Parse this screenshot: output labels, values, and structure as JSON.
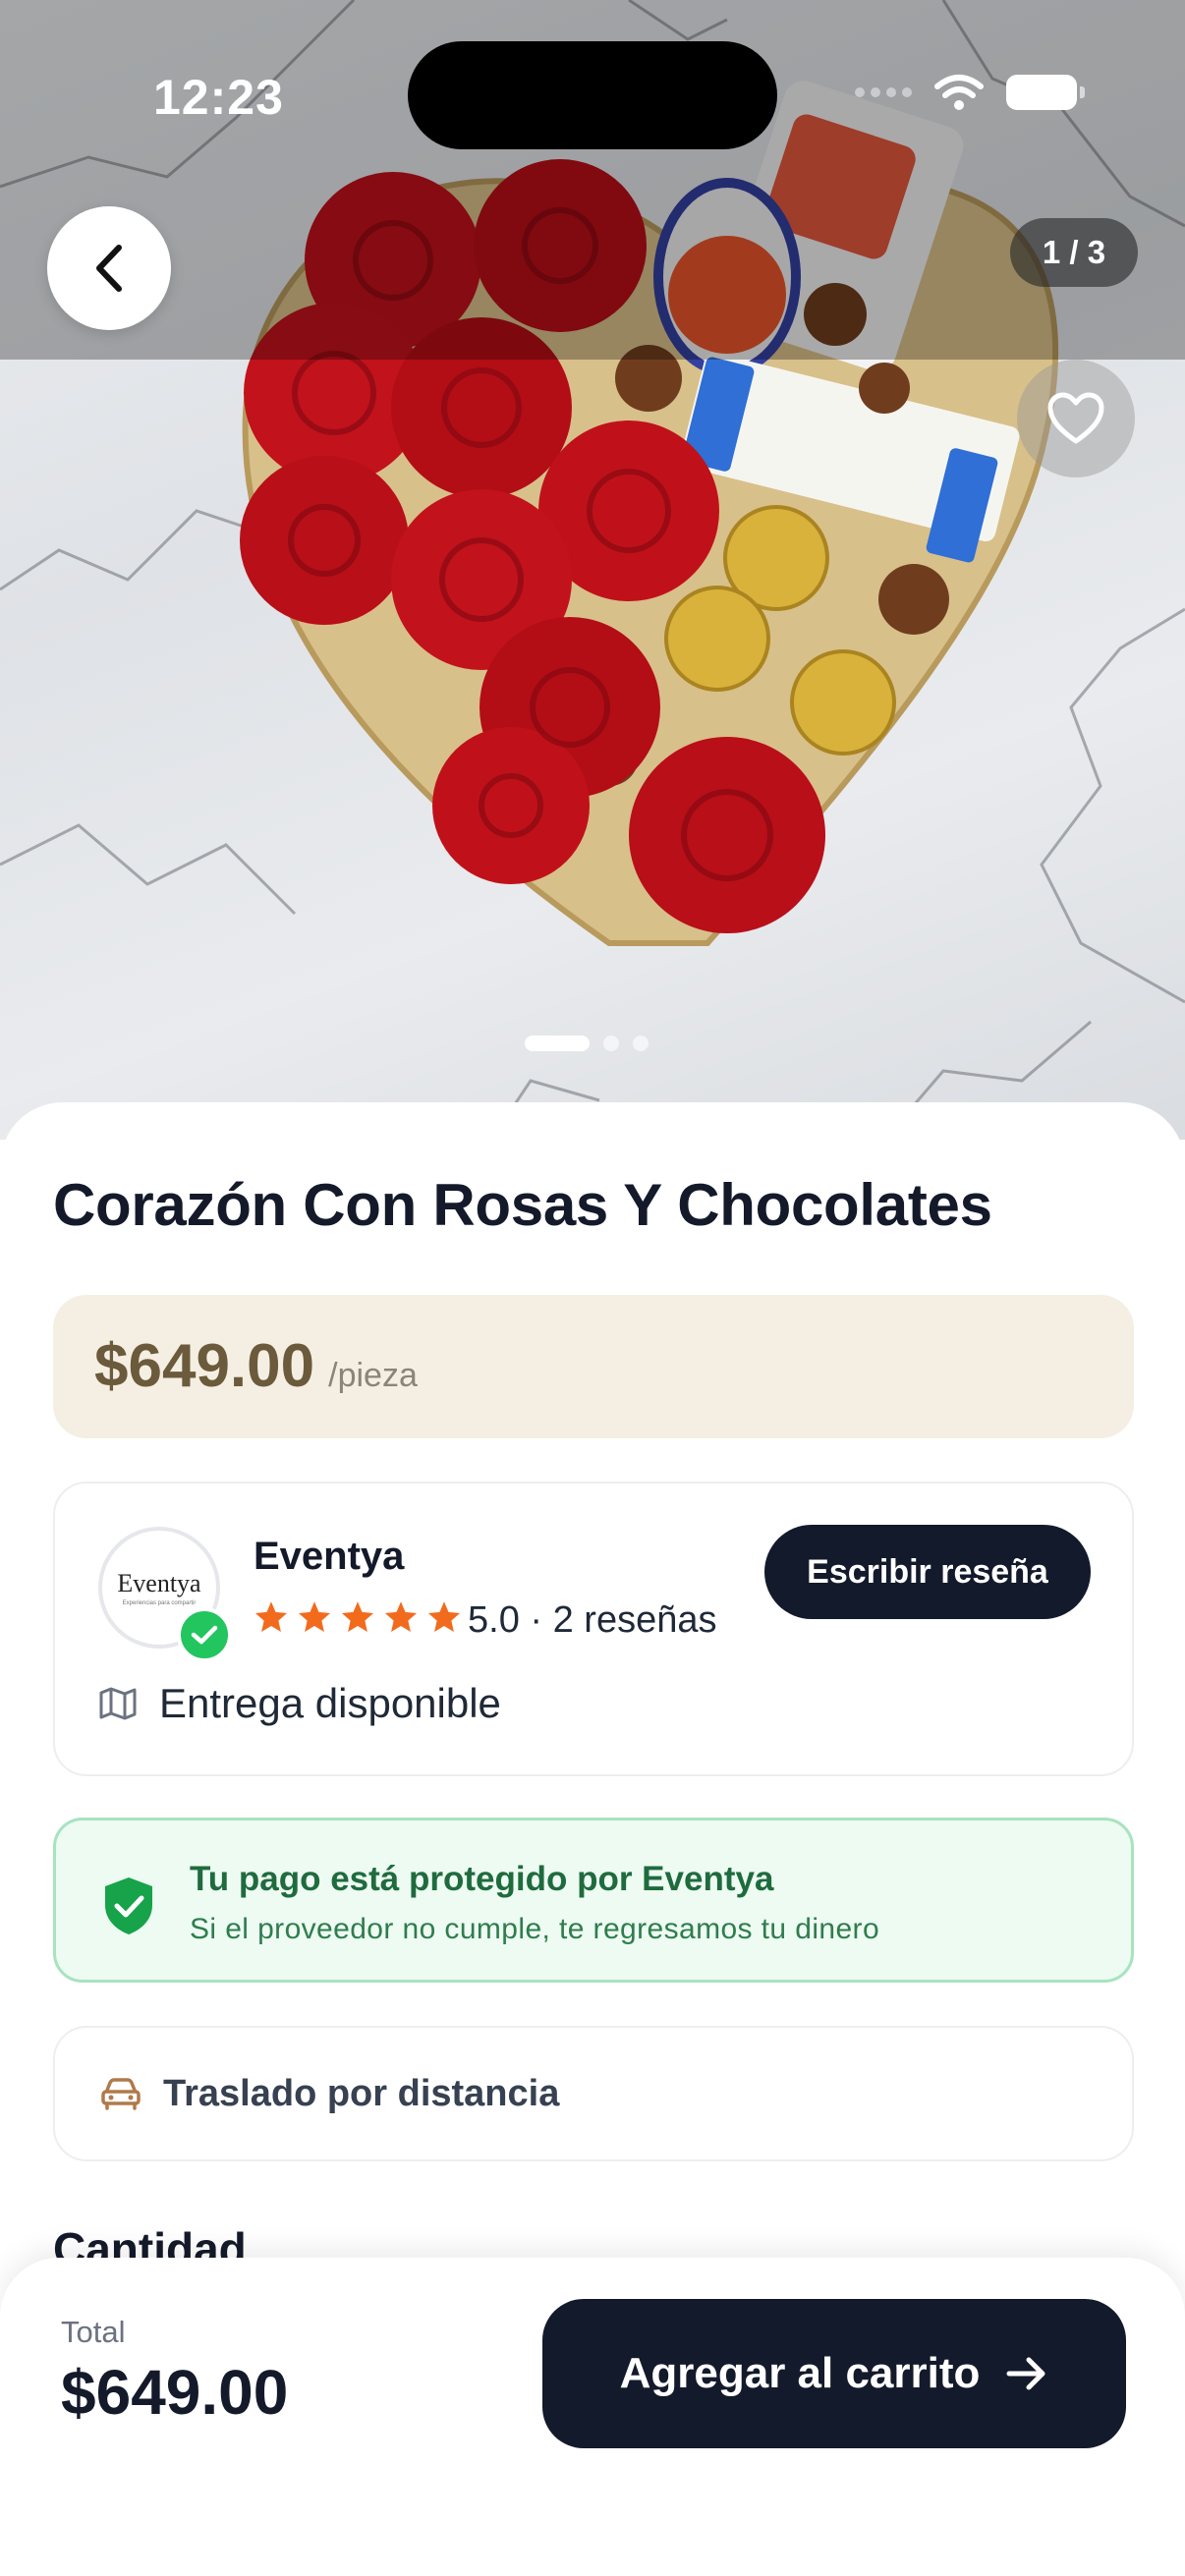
{
  "status_bar": {
    "time": "12:23"
  },
  "gallery": {
    "counter": "1 / 3",
    "total_images": 3,
    "active_index": 0
  },
  "product": {
    "title": "Corazón Con Rosas Y Chocolates",
    "price": "$649.00",
    "unit": "/pieza"
  },
  "vendor": {
    "name": "Eventya",
    "logo_text": "Eventya",
    "logo_tagline": "Experiencias para compartir",
    "rating_stars": 5,
    "rating_text": "5.0 · 2 reseñas",
    "review_button": "Escribir reseña",
    "delivery_label": "Entrega disponible"
  },
  "protection": {
    "title": "Tu pago está protegido por Eventya",
    "subtitle": "Si el proveedor no cumple, te regresamos tu dinero"
  },
  "shipping": {
    "label": "Traslado por distancia"
  },
  "quantity_section": {
    "title": "Cantidad"
  },
  "footer": {
    "total_label": "Total",
    "total_value": "$649.00",
    "cart_button": "Agregar al carrito"
  },
  "colors": {
    "primary_dark": "#131a2b",
    "price_bg": "#f4efe2",
    "price_text": "#6b5a3b",
    "star": "#f26b1d",
    "verified": "#22c55e",
    "protect_bg": "#edfbf2",
    "protect_border": "#a7e3bf",
    "protect_text": "#1f6b3e"
  },
  "icons": {
    "back": "chevron-left-icon",
    "favorite": "heart-icon",
    "verified": "check-icon",
    "star": "star-icon",
    "map": "map-icon",
    "shield": "shield-check-icon",
    "car": "car-icon",
    "arrow": "arrow-right-icon"
  }
}
